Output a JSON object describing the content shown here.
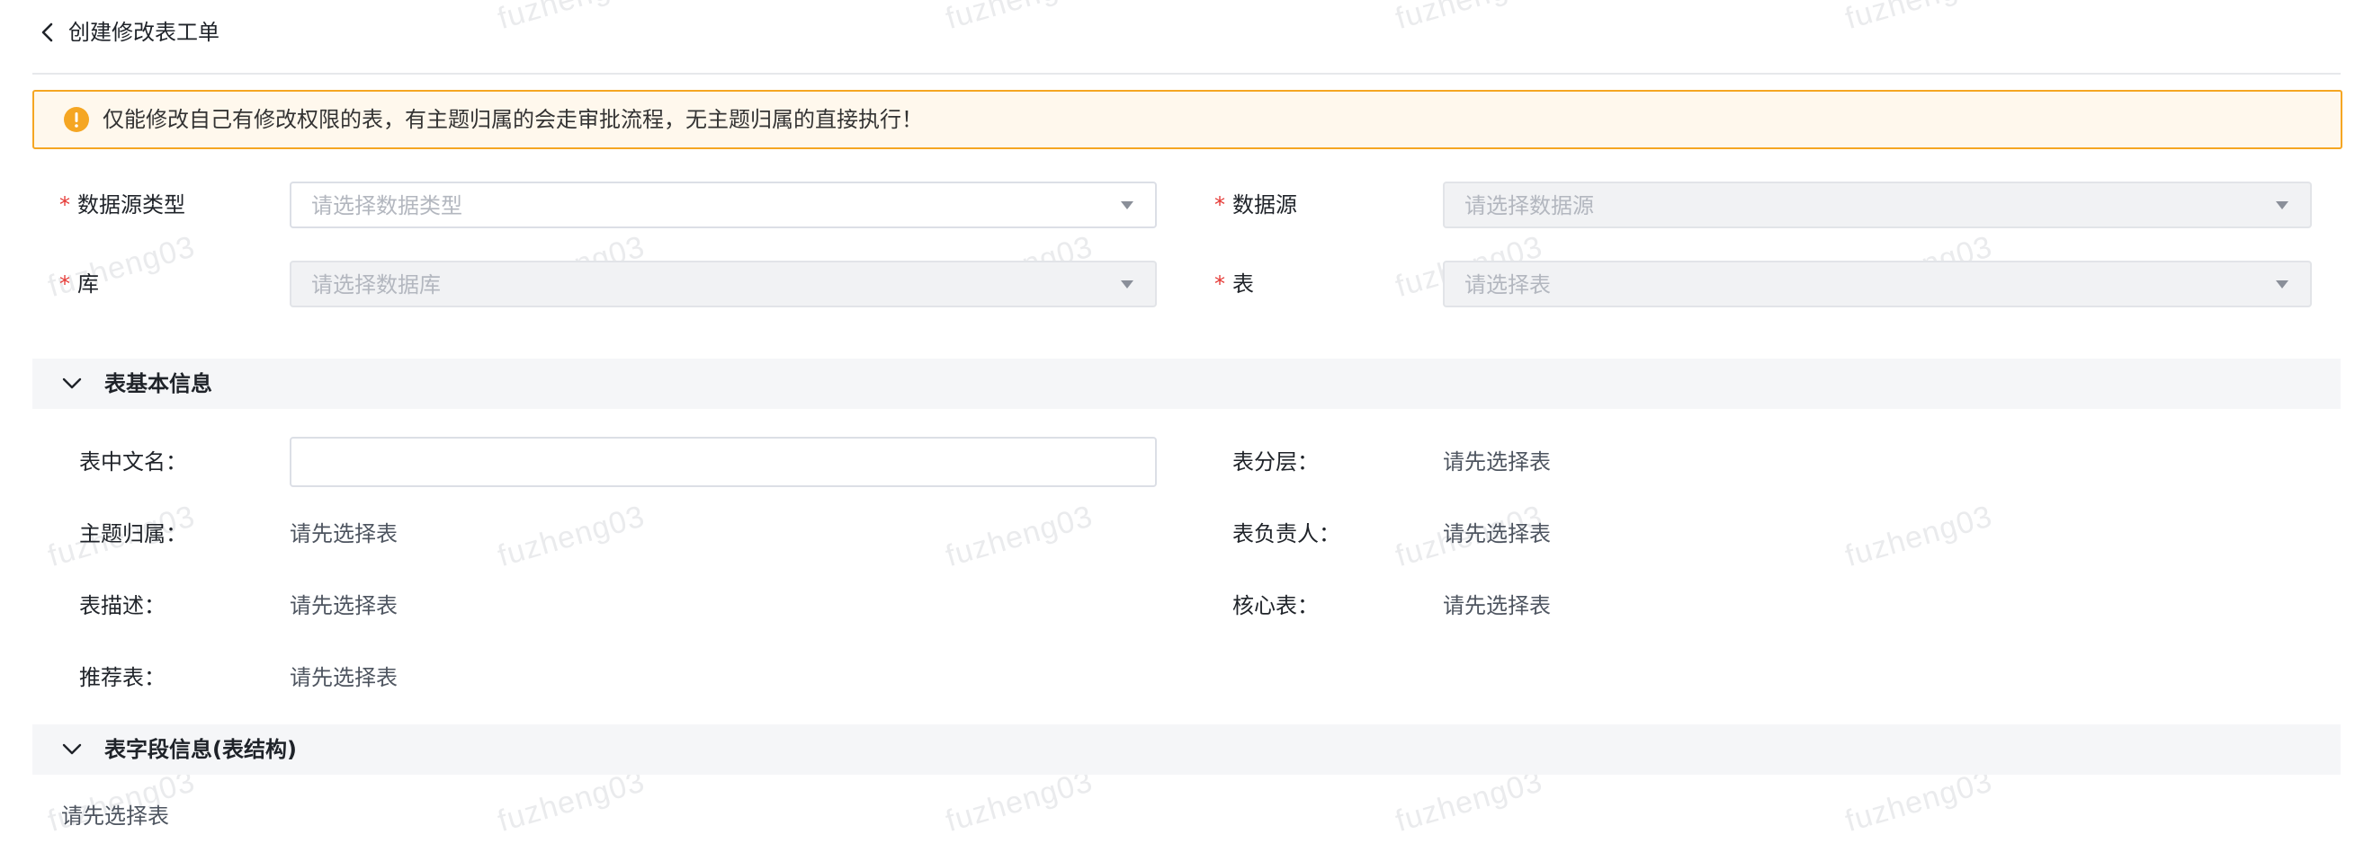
{
  "header": {
    "title": "创建修改表工单"
  },
  "alert": {
    "text": "仅能修改自己有修改权限的表，有主题归属的会走审批流程，无主题归属的直接执行！"
  },
  "form": {
    "datasource_type": {
      "label": "数据源类型",
      "placeholder": "请选择数据类型",
      "required": "*"
    },
    "datasource": {
      "label": "数据源",
      "placeholder": "请选择数据源",
      "required": "*"
    },
    "database": {
      "label": "库",
      "placeholder": "请选择数据库",
      "required": "*"
    },
    "table": {
      "label": "表",
      "placeholder": "请选择表",
      "required": "*"
    }
  },
  "basic_info": {
    "title": "表基本信息",
    "cn_name_label": "表中文名：",
    "layer_label": "表分层：",
    "layer_value": "请先选择表",
    "theme_label": "主题归属：",
    "theme_value": "请先选择表",
    "owner_label": "表负责人：",
    "owner_value": "请先选择表",
    "desc_label": "表描述：",
    "desc_value": "请先选择表",
    "core_label": "核心表：",
    "core_value": "请先选择表",
    "recommend_label": "推荐表：",
    "recommend_value": "请先选择表"
  },
  "field_info": {
    "title": "表字段信息(表结构)",
    "empty_text": "请先选择表"
  },
  "watermark": {
    "text": "fuzheng03"
  },
  "colors": {
    "warning": "#f5a623",
    "required": "#e53935",
    "section_bg": "#f5f6f8"
  }
}
